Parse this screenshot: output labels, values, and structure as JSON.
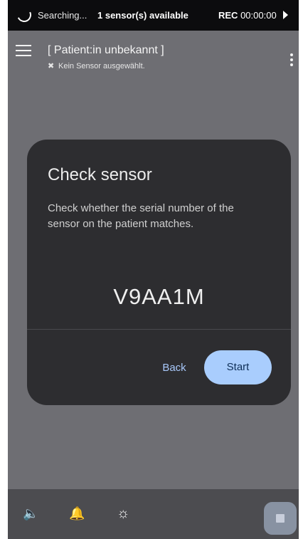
{
  "status_bar": {
    "searching": "Searching...",
    "sensors": "1 sensor(s) available",
    "rec_label": "REC",
    "rec_time": "00:00:00"
  },
  "header": {
    "patient": "[ Patient:in unbekannt ]",
    "sensor_status": "Kein Sensor ausgewählt.",
    "nosensor_icon": "✖"
  },
  "dialog": {
    "title": "Check sensor",
    "message": "Check whether the serial number of the sensor on the patient matches.",
    "serial": "V9AA1M",
    "back_label": "Back",
    "start_label": "Start"
  },
  "bottom_bar": {
    "volume_icon": "🔈",
    "alarm_icon": "🔔",
    "brightness_icon": "☼",
    "stop_icon": "stop-square-icon"
  },
  "colors": {
    "background": "#6e6e73",
    "dialog": "#2d2d30",
    "accent": "#a9cdfd",
    "status_bar": "#0c0c0e"
  }
}
